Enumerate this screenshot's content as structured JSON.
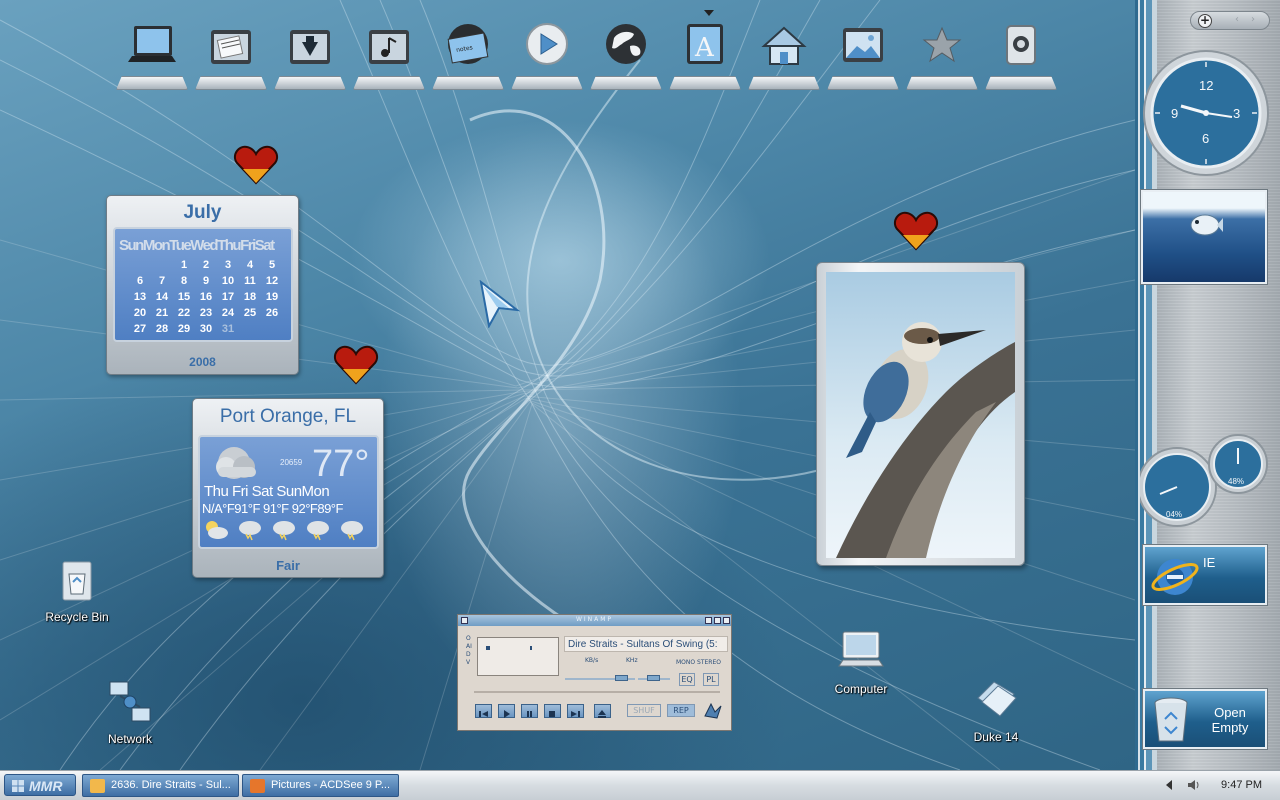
{
  "dock": {
    "items": [
      {
        "id": "computer",
        "icon": "laptop-icon"
      },
      {
        "id": "documents",
        "icon": "documents-folder-icon"
      },
      {
        "id": "downloads",
        "icon": "downloads-folder-icon"
      },
      {
        "id": "music",
        "icon": "music-folder-icon"
      },
      {
        "id": "notes",
        "icon": "notes-icon"
      },
      {
        "id": "media-player",
        "icon": "play-icon"
      },
      {
        "id": "internet",
        "icon": "globe-icon"
      },
      {
        "id": "fonts",
        "icon": "font-icon"
      },
      {
        "id": "home",
        "icon": "home-icon"
      },
      {
        "id": "pictures",
        "icon": "pictures-icon"
      },
      {
        "id": "favorites",
        "icon": "star-icon"
      },
      {
        "id": "trash",
        "icon": "trash-icon"
      }
    ]
  },
  "calendar": {
    "month": "July",
    "dow": "SunMonTueWedThuFriSat",
    "weeks": [
      [
        "",
        "",
        "1",
        "2",
        "3",
        "4",
        "5"
      ],
      [
        "6",
        "7",
        "8",
        "9",
        "10",
        "11",
        "12"
      ],
      [
        "13",
        "14",
        "15",
        "16",
        "17",
        "18",
        "19"
      ],
      [
        "20",
        "21",
        "22",
        "23",
        "24",
        "25",
        "26"
      ],
      [
        "27",
        "28",
        "29",
        "30",
        "31",
        "",
        ""
      ]
    ],
    "dimmed_day": "31",
    "year": "2008"
  },
  "weather": {
    "city": "Port Orange, FL",
    "code": "20659",
    "temp": "77°",
    "days_row": "Thu  Fri  Sat SunMon",
    "temps_row": "N/A°F91°F 91°F 92°F89°F",
    "condition": "Fair"
  },
  "desktop_icons": {
    "recycle_bin": "Recycle Bin",
    "network": "Network",
    "computer": "Computer",
    "duke": "Duke 14"
  },
  "winamp": {
    "title": "WINAMP",
    "song": "Dire Straits - Sultans Of Swing (5:",
    "kbps": "KB/s",
    "khz": "KHz",
    "mono_stereo": "MONO STEREO",
    "eq": "EQ",
    "pl": "PL",
    "shuf": "SHUF",
    "rep": "REP",
    "side": "OAIDV"
  },
  "sidebar": {
    "clock": {
      "n12": "12",
      "n3": "3",
      "n6": "6",
      "n9": "9"
    },
    "cpu_percent": "04%",
    "mem_percent": "48%",
    "ie_label": "IE",
    "bin_label": "Open\nEmpty"
  },
  "taskbar": {
    "start_label": "MMR",
    "tasks": [
      {
        "label": "2636. Dire Straits - Sul..."
      },
      {
        "label": "Pictures - ACDSee 9 P..."
      }
    ],
    "clock": "9:47 PM"
  },
  "colors": {
    "accent": "#3a6ea8",
    "wallpaper": "#4c86a7",
    "taskbar_button": "#3e6ea4"
  }
}
